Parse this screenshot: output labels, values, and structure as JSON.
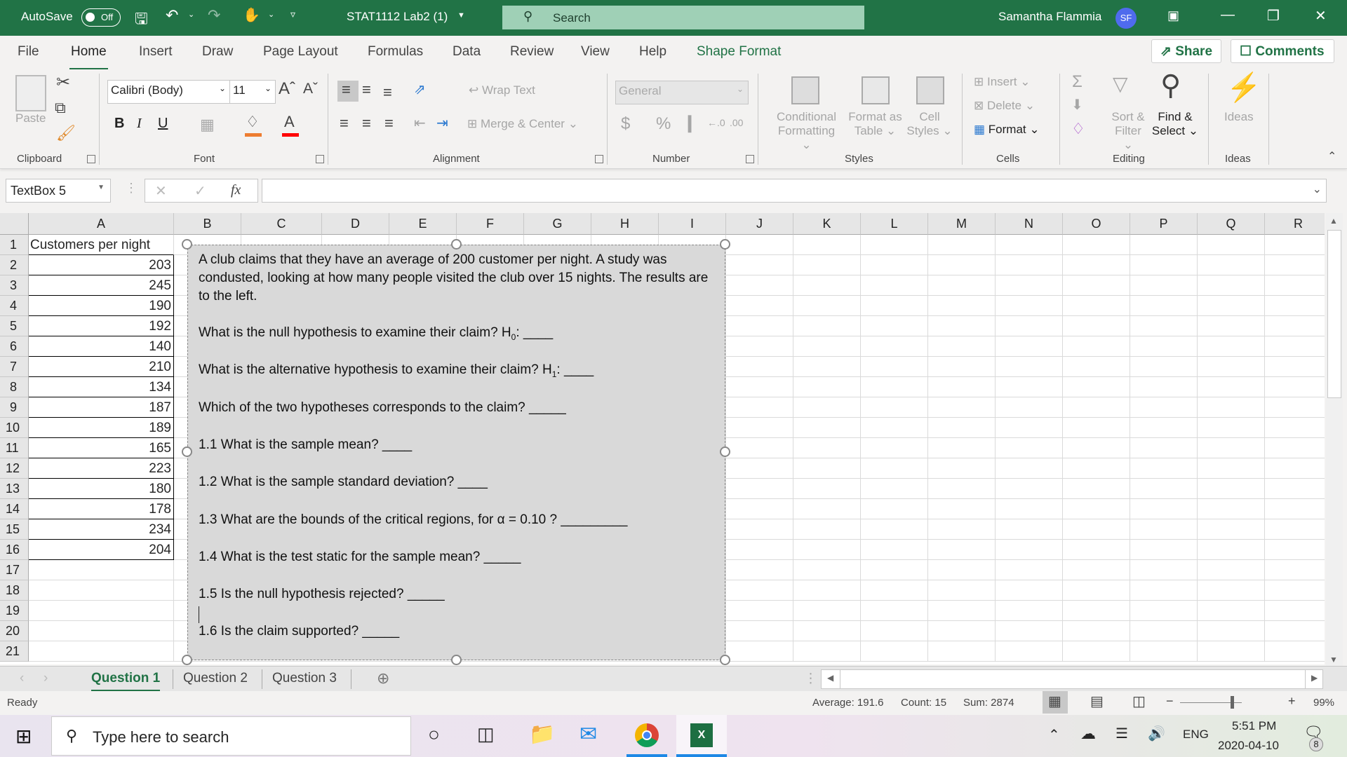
{
  "titlebar": {
    "autosave_label": "AutoSave",
    "autosave_state": "Off",
    "document_title": "STAT1112 Lab2 (1)",
    "search_placeholder": "Search",
    "user_name": "Samantha Flammia",
    "user_initials": "SF"
  },
  "ribbon_tabs": [
    {
      "label": "File"
    },
    {
      "label": "Home"
    },
    {
      "label": "Insert"
    },
    {
      "label": "Draw"
    },
    {
      "label": "Page Layout"
    },
    {
      "label": "Formulas"
    },
    {
      "label": "Data"
    },
    {
      "label": "Review"
    },
    {
      "label": "View"
    },
    {
      "label": "Help"
    },
    {
      "label": "Shape Format"
    }
  ],
  "share_label": "Share",
  "comments_label": "Comments",
  "ribbon": {
    "clipboard": {
      "paste": "Paste",
      "group": "Clipboard"
    },
    "font": {
      "name": "Calibri (Body)",
      "size": "11",
      "bold": "B",
      "italic": "I",
      "underline": "U",
      "group": "Font"
    },
    "alignment": {
      "wrap_text": "Wrap Text",
      "merge_center": "Merge & Center",
      "group": "Alignment"
    },
    "number": {
      "format": "General",
      "currency": "$",
      "percent": "%",
      "comma": "9",
      "group": "Number"
    },
    "styles": {
      "conditional_1": "Conditional",
      "conditional_2": "Formatting",
      "format_table_1": "Format as",
      "format_table_2": "Table",
      "cell_styles_1": "Cell",
      "cell_styles_2": "Styles",
      "group": "Styles"
    },
    "cells": {
      "insert": "Insert",
      "delete": "Delete",
      "format": "Format",
      "group": "Cells"
    },
    "editing": {
      "sort_1": "Sort &",
      "sort_2": "Filter",
      "find_1": "Find &",
      "find_2": "Select",
      "group": "Editing"
    },
    "ideas": {
      "label": "Ideas",
      "group": "Ideas"
    }
  },
  "formula_bar": {
    "name_box": "TextBox 5",
    "fx": "fx",
    "formula": ""
  },
  "columns": [
    "A",
    "B",
    "C",
    "D",
    "E",
    "F",
    "G",
    "H",
    "I",
    "J",
    "K",
    "L",
    "M",
    "N",
    "O",
    "P",
    "Q",
    "R"
  ],
  "rows": [
    "1",
    "2",
    "3",
    "4",
    "5",
    "6",
    "7",
    "8",
    "9",
    "10",
    "11",
    "12",
    "13",
    "14",
    "15",
    "16",
    "17",
    "18",
    "19",
    "20",
    "21"
  ],
  "column_a": {
    "header": "Customers per night",
    "values": [
      "203",
      "245",
      "190",
      "192",
      "140",
      "210",
      "134",
      "187",
      "189",
      "165",
      "223",
      "180",
      "178",
      "234",
      "204"
    ]
  },
  "textbox": {
    "intro": "A club claims that they have an average of 200 customer per night. A study was condusted, looking at how many people visited the club over 15 nights. The results are to the left.",
    "q_null_pre": "What is the null hypothesis to examine their claim? H",
    "q_null_sub": "0",
    "q_null_post": ": ____",
    "q_alt_pre": "What is the alternative hypothesis to examine their claim? H",
    "q_alt_sub": "1",
    "q_alt_post": ": ____",
    "q_claim": "Which of the two hypotheses corresponds to the claim? _____",
    "q1_1": "1.1 What is the sample mean? ____",
    "q1_2": "1.2 What is the sample standard deviation? ____",
    "q1_3": "1.3 What are the bounds of the critical regions, for α = 0.10 ? _________",
    "q1_4": "1.4 What is the test static for the sample mean? _____",
    "q1_5": "1.5 Is the null hypothesis rejected? _____",
    "q1_6": "1.6 Is the claim supported? _____"
  },
  "sheet_tabs": [
    {
      "label": "Question 1",
      "active": true
    },
    {
      "label": "Question 2",
      "active": false
    },
    {
      "label": "Question 3",
      "active": false
    }
  ],
  "status": {
    "mode": "Ready",
    "average": "Average: 191.6",
    "count": "Count: 15",
    "sum": "Sum: 2874",
    "zoom": "99%"
  },
  "taskbar": {
    "search_placeholder": "Type here to search",
    "language": "ENG",
    "time": "5:51 PM",
    "date": "2020-04-10",
    "notifications": "8"
  }
}
